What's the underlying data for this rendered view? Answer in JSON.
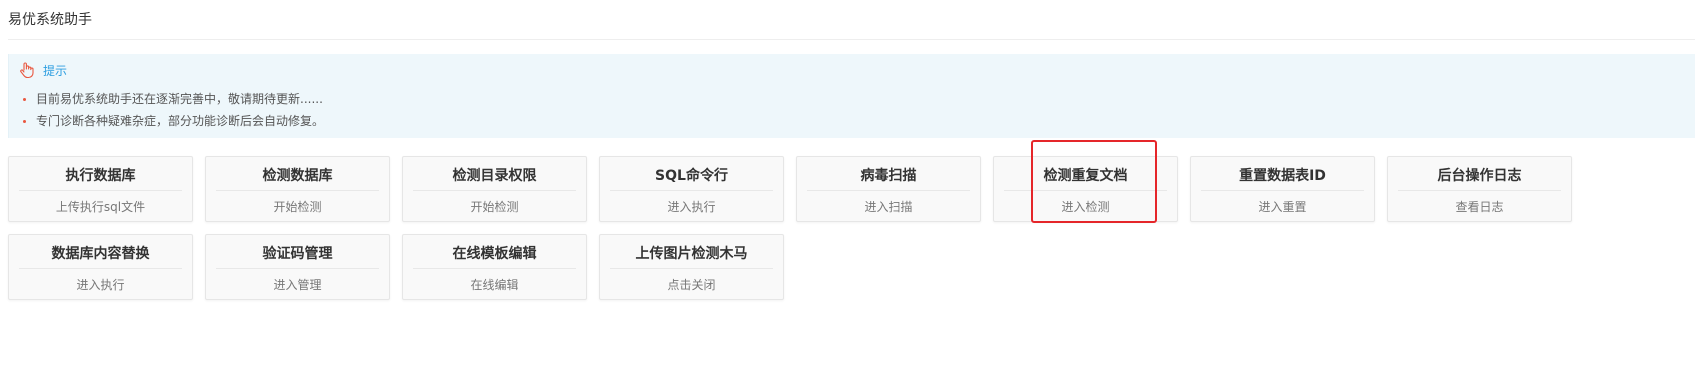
{
  "header": {
    "title": "易优系统助手"
  },
  "tip": {
    "icon": "pointing-hand-icon",
    "label": "提示",
    "items": [
      "目前易优系统助手还在逐渐完善中，敬请期待更新......",
      "专门诊断各种疑难杂症，部分功能诊断后会自动修复。"
    ]
  },
  "tools": {
    "row1": [
      {
        "title": "执行数据库",
        "action": "上传执行sql文件"
      },
      {
        "title": "检测数据库",
        "action": "开始检测"
      },
      {
        "title": "检测目录权限",
        "action": "开始检测"
      },
      {
        "title": "SQL命令行",
        "action": "进入执行"
      },
      {
        "title": "病毒扫描",
        "action": "进入扫描"
      },
      {
        "title": "检测重复文档",
        "action": "进入检测"
      },
      {
        "title": "重置数据表ID",
        "action": "进入重置"
      },
      {
        "title": "后台操作日志",
        "action": "查看日志"
      }
    ],
    "row2": [
      {
        "title": "数据库内容替换",
        "action": "进入执行"
      },
      {
        "title": "验证码管理",
        "action": "进入管理"
      },
      {
        "title": "在线模板编辑",
        "action": "在线编辑"
      },
      {
        "title": "上传图片检测木马",
        "action": "点击关闭"
      }
    ]
  },
  "colors": {
    "tip_background": "#eef7fb",
    "tip_label": "#2d9ee0",
    "bullet": "#e9573f",
    "highlight": "#e5262a"
  }
}
